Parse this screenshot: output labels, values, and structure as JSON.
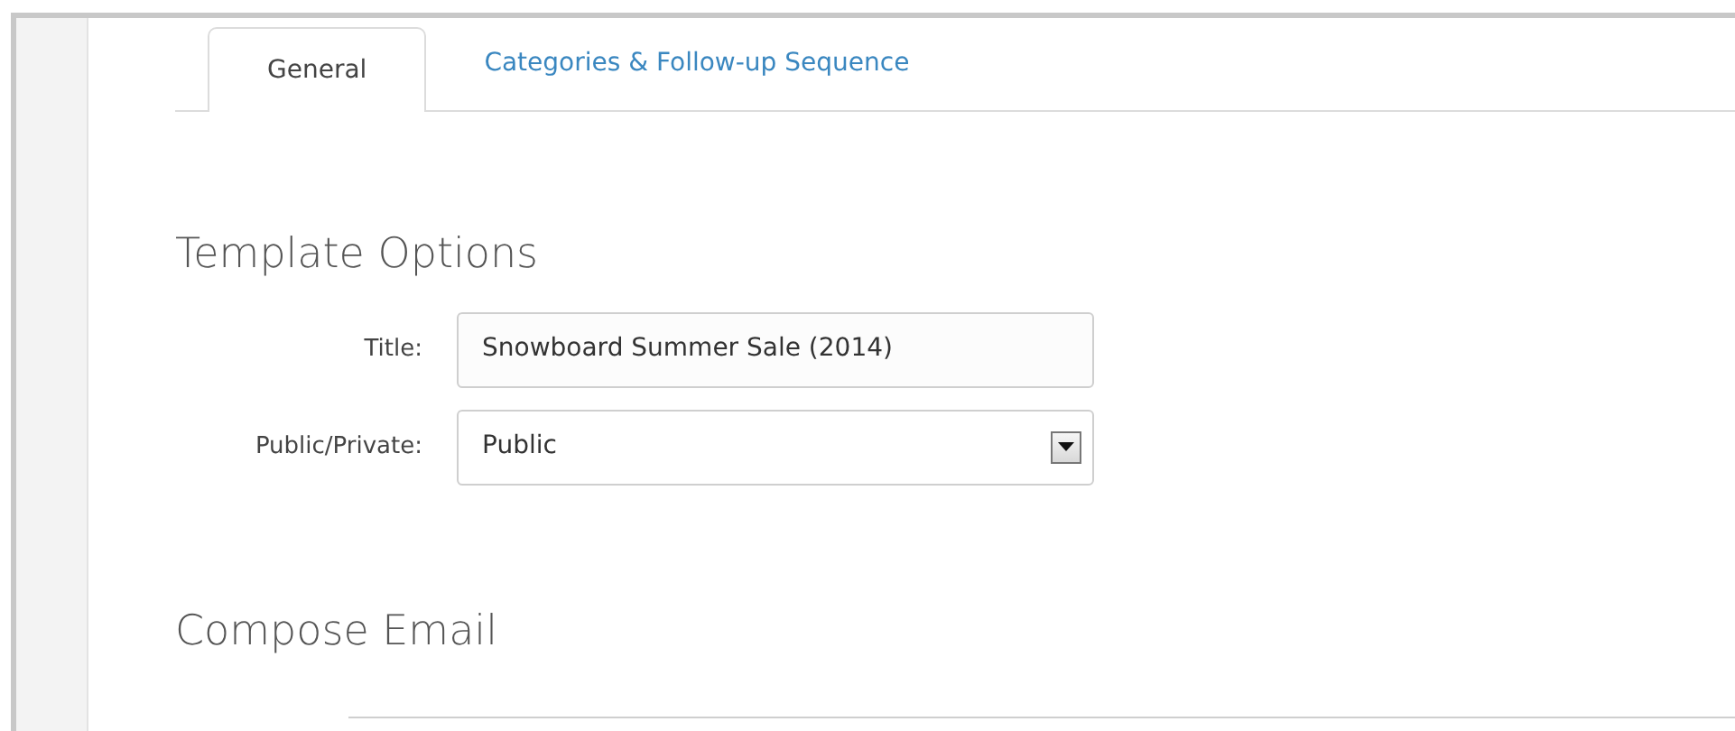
{
  "tabs": [
    {
      "label": "General",
      "selected": true
    },
    {
      "label": "Categories & Follow-up Sequence",
      "selected": false
    }
  ],
  "sections": [
    {
      "heading": "Template Options",
      "fields": [
        {
          "kind": "text",
          "label": "Title:",
          "value": "Snowboard Summer Sale (2014)"
        },
        {
          "kind": "select",
          "label": "Public/Private:",
          "value": "Public"
        }
      ]
    },
    {
      "heading": "Compose Email"
    }
  ]
}
